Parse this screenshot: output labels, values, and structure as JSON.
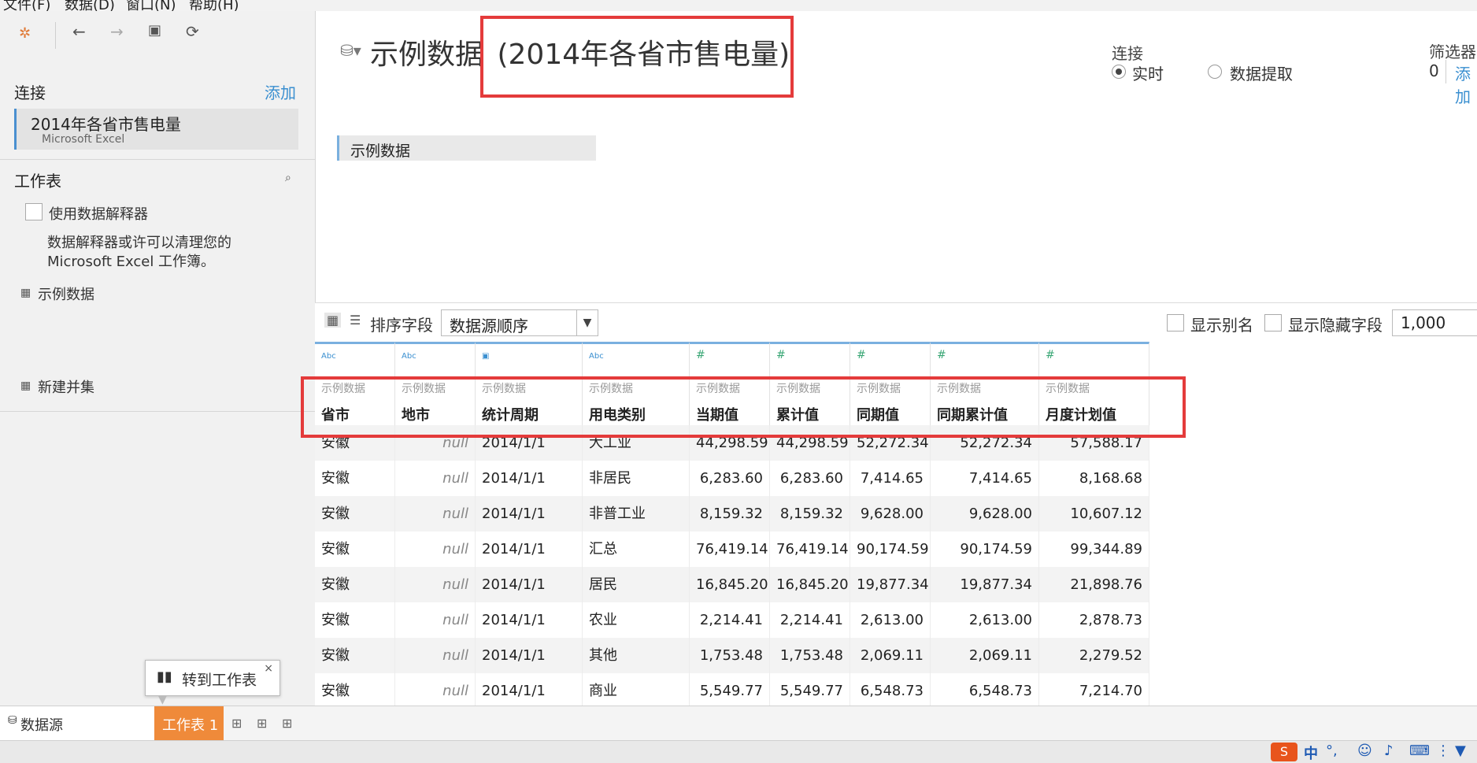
{
  "menu": [
    "文件(F)",
    "数据(D)",
    "窗口(N)",
    "帮助(H)"
  ],
  "left": {
    "connections_title": "连接",
    "add_label": "添加",
    "connection": {
      "name": "2014年各省市售电量",
      "type": "Microsoft Excel"
    },
    "sheets_title": "工作表",
    "use_interpreter": "使用数据解释器",
    "interpreter_desc_1": "数据解释器或许可以清理您的",
    "interpreter_desc_2": "Microsoft Excel 工作簿。",
    "sheet_item": "示例数据",
    "new_union": "新建并集"
  },
  "header": {
    "title_main": "示例数据",
    "title_paren": "(2014年各省市售电量)",
    "connection_label": "连接",
    "live_label": "实时",
    "extract_label": "数据提取",
    "filter_label": "筛选器",
    "filter_count": "0",
    "filter_add": "添加"
  },
  "canvas": {
    "table_name": "示例数据"
  },
  "toolbar": {
    "sort_label": "排序字段",
    "sort_value": "数据源顺序",
    "show_alias": "显示别名",
    "show_hidden": "显示隐藏字段",
    "rows_value": "1,000"
  },
  "grid": {
    "columns": [
      {
        "type": "Abc",
        "source": "示例数据",
        "name": "省市"
      },
      {
        "type": "Abc",
        "source": "示例数据",
        "name": "地市"
      },
      {
        "type": "date",
        "source": "示例数据",
        "name": "统计周期"
      },
      {
        "type": "Abc",
        "source": "示例数据",
        "name": "用电类别"
      },
      {
        "type": "#",
        "source": "示例数据",
        "name": "当期值"
      },
      {
        "type": "#",
        "source": "示例数据",
        "name": "累计值"
      },
      {
        "type": "#",
        "source": "示例数据",
        "name": "同期值"
      },
      {
        "type": "#",
        "source": "示例数据",
        "name": "同期累计值"
      },
      {
        "type": "#",
        "source": "示例数据",
        "name": "月度计划值"
      }
    ],
    "rows": [
      [
        "安徽",
        "null",
        "2014/1/1",
        "大工业",
        "44,298.59",
        "44,298.59",
        "52,272.34",
        "52,272.34",
        "57,588.17"
      ],
      [
        "安徽",
        "null",
        "2014/1/1",
        "非居民",
        "6,283.60",
        "6,283.60",
        "7,414.65",
        "7,414.65",
        "8,168.68"
      ],
      [
        "安徽",
        "null",
        "2014/1/1",
        "非普工业",
        "8,159.32",
        "8,159.32",
        "9,628.00",
        "9,628.00",
        "10,607.12"
      ],
      [
        "安徽",
        "null",
        "2014/1/1",
        "汇总",
        "76,419.14",
        "76,419.14",
        "90,174.59",
        "90,174.59",
        "99,344.89"
      ],
      [
        "安徽",
        "null",
        "2014/1/1",
        "居民",
        "16,845.20",
        "16,845.20",
        "19,877.34",
        "19,877.34",
        "21,898.76"
      ],
      [
        "安徽",
        "null",
        "2014/1/1",
        "农业",
        "2,214.41",
        "2,214.41",
        "2,613.00",
        "2,613.00",
        "2,878.73"
      ],
      [
        "安徽",
        "null",
        "2014/1/1",
        "其他",
        "1,753.48",
        "1,753.48",
        "2,069.11",
        "2,069.11",
        "2,279.52"
      ],
      [
        "安徽",
        "null",
        "2014/1/1",
        "商业",
        "5,549.77",
        "5,549.77",
        "6,548.73",
        "6,548.73",
        "7,214.70"
      ]
    ]
  },
  "tooltip": {
    "goto_sheet": "转到工作表"
  },
  "tabs": {
    "datasource": "数据源",
    "sheet1": "工作表 1"
  },
  "colors": {
    "accent": "#ef8a3a",
    "highlight_red": "#e43b3b",
    "link": "#3a8fd0"
  }
}
